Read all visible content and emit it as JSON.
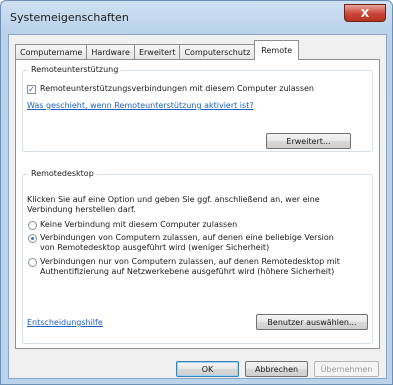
{
  "window": {
    "title": "Systemeigenschaften",
    "close_glyph": "X"
  },
  "tabs": [
    {
      "label": "Computername"
    },
    {
      "label": "Hardware"
    },
    {
      "label": "Erweitert"
    },
    {
      "label": "Computerschutz"
    },
    {
      "label": "Remote"
    }
  ],
  "remote_assistance": {
    "group_title": "Remoteunterstützung",
    "checkbox_label": "Remoteunterstützungsverbindungen mit diesem Computer zulassen",
    "checkbox_checked": true,
    "help_link": "Was geschieht, wenn Remoteunterstützung aktiviert ist?",
    "advanced_button": "Erweitert..."
  },
  "remote_desktop": {
    "group_title": "Remotedesktop",
    "instruction": "Klicken Sie auf eine Option und geben Sie ggf. anschließend an, wer eine Verbindung herstellen darf.",
    "options": [
      {
        "label": "Keine Verbindung mit diesem Computer zulassen",
        "selected": false
      },
      {
        "label": "Verbindungen von Computern zulassen, auf denen eine beliebige Version von Remotedesktop ausgeführt wird (weniger Sicherheit)",
        "selected": true
      },
      {
        "label": "Verbindungen nur von Computern zulassen, auf denen Remotedesktop mit Authentifizierung auf Netzwerkebene ausgeführt wird (höhere Sicherheit)",
        "selected": false
      }
    ],
    "help_link": "Entscheidungshilfe",
    "select_users_button": "Benutzer auswählen..."
  },
  "footer": {
    "ok": "OK",
    "cancel": "Abbrechen",
    "apply": "Übernehmen"
  }
}
